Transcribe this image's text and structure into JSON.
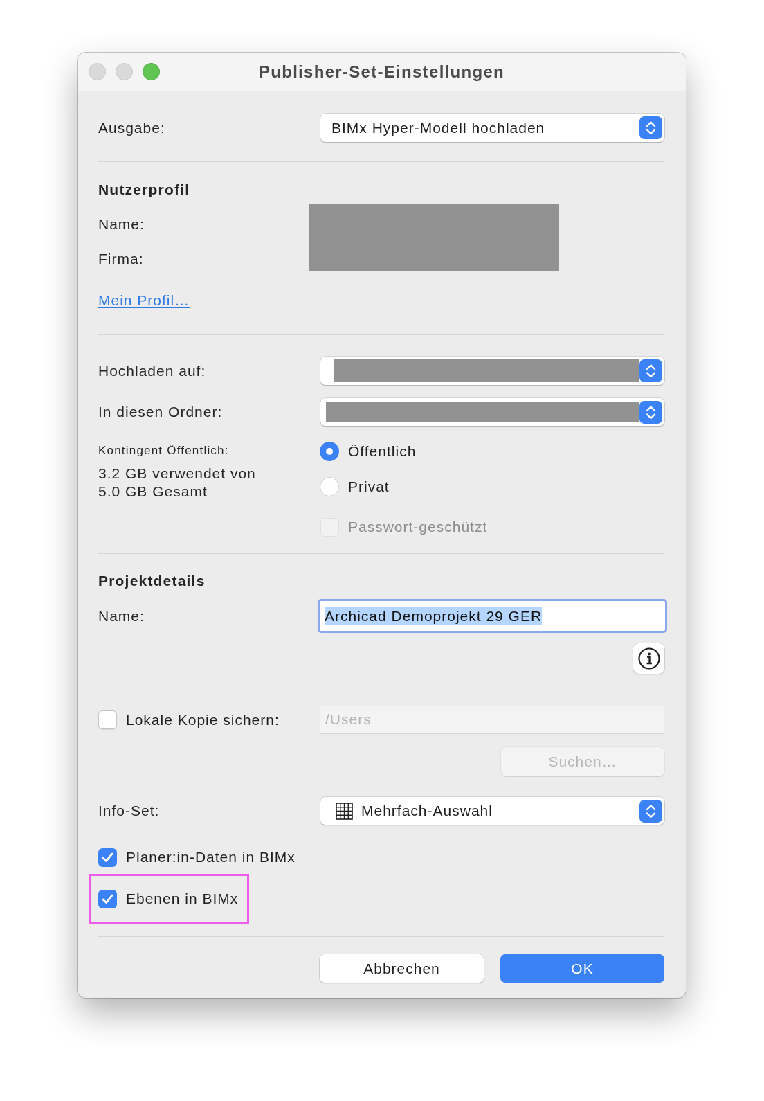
{
  "window": {
    "title": "Publisher-Set-Einstellungen",
    "buttons": [
      {
        "kind": "close",
        "enabled": false
      },
      {
        "kind": "minimize",
        "enabled": false
      },
      {
        "kind": "zoom",
        "enabled": true
      }
    ]
  },
  "output": {
    "label": "Ausgabe:",
    "value": "BIMx Hyper-Modell hochladen"
  },
  "user_profile": {
    "heading": "Nutzerprofil",
    "fields": [
      {
        "label": "Name:"
      },
      {
        "label": "Firma:"
      }
    ],
    "redacted": true,
    "link": "Mein Profil…"
  },
  "upload": {
    "fields": [
      {
        "label": "Hochladen auf:",
        "redacted": true
      },
      {
        "label": "In diesen Ordner:",
        "redacted": true
      }
    ],
    "quota_label": "Kontingent Öffentlich:",
    "quota_usage": "3.2 GB verwendet von\n5.0 GB Gesamt",
    "visibility": [
      {
        "label": "Öffentlich",
        "selected": true
      },
      {
        "label": "Privat",
        "selected": false
      }
    ],
    "password": {
      "label": "Passwort-geschützt",
      "checked": false,
      "disabled": true
    }
  },
  "project": {
    "heading": "Projektdetails",
    "name": {
      "label": "Name:",
      "value": "Archicad Demoprojekt 29 GER",
      "focused": true,
      "text_selected": true
    },
    "local_copy": {
      "label": "Lokale Kopie sichern:",
      "checked": false,
      "path": "/Users",
      "path_disabled": true
    },
    "browse_button": {
      "label": "Suchen…",
      "disabled": true
    },
    "info_set": {
      "label": "Info-Set:",
      "value": "Mehrfach-Auswahl"
    },
    "options": [
      {
        "label": "Planer:in-Daten in BIMx",
        "checked": true,
        "highlighted": false
      },
      {
        "label": "Ebenen in BIMx",
        "checked": true,
        "highlighted": true
      }
    ]
  },
  "buttons": [
    {
      "label": "Abbrechen",
      "default": false
    },
    {
      "label": "OK",
      "default": true
    }
  ]
}
